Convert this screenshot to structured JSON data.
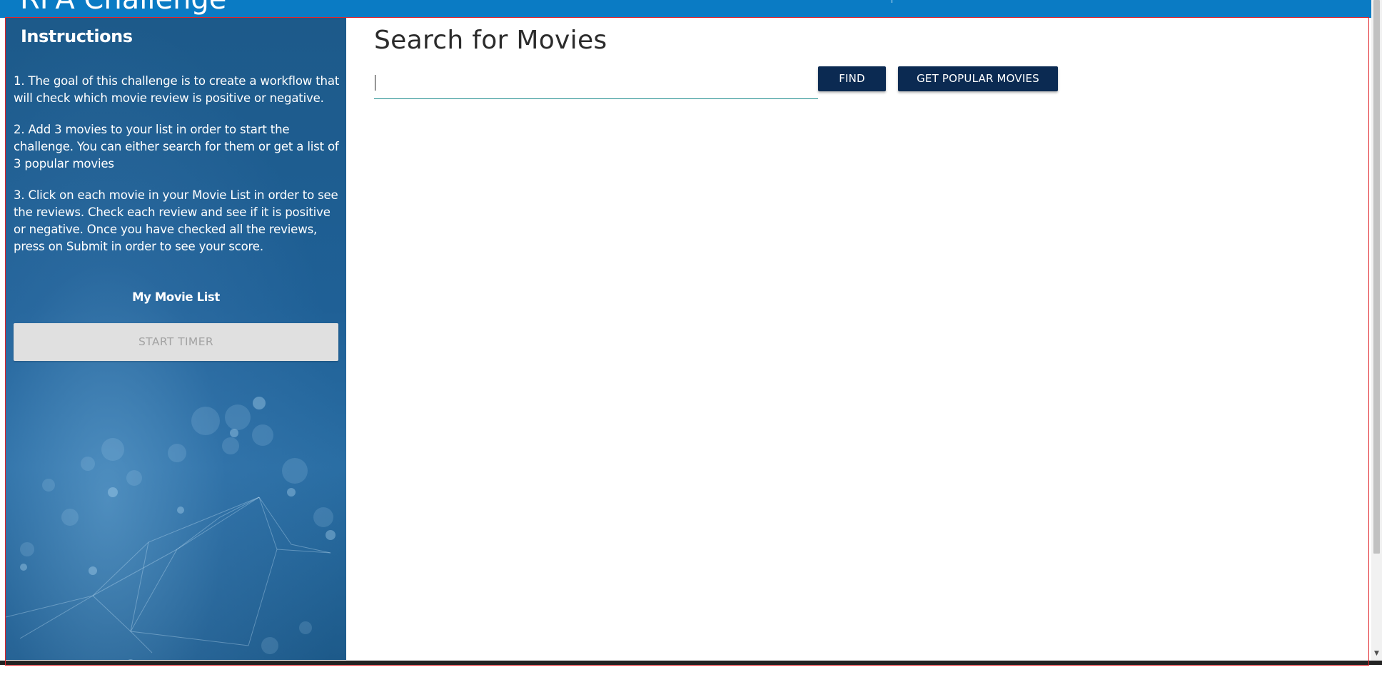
{
  "app": {
    "title": "RPA Challenge"
  },
  "sidebar": {
    "heading": "Instructions",
    "instructions": [
      "1. The goal of this challenge is to create a workflow that will check which movie review is positive or negative.",
      "2. Add 3 movies to your list in order to start the challenge. You can either search for them or get a list of 3 popular movies",
      "3. Click on each movie in your Movie List in order to see the reviews. Check each review and see if it is positive or negative. Once you have checked all the reviews, press on Submit in order to see your score."
    ],
    "movie_list_title": "My Movie List",
    "start_timer_label": "START TIMER"
  },
  "main": {
    "title": "Search for Movies",
    "search_value": "",
    "find_label": "FIND",
    "popular_label": "GET POPULAR MOVIES"
  },
  "colors": {
    "topbar": "#0a7bc4",
    "sidebar": "#1f5d8c",
    "button": "#0b2a52",
    "input_underline": "#1a8a8c",
    "frame": "#e0242a"
  }
}
